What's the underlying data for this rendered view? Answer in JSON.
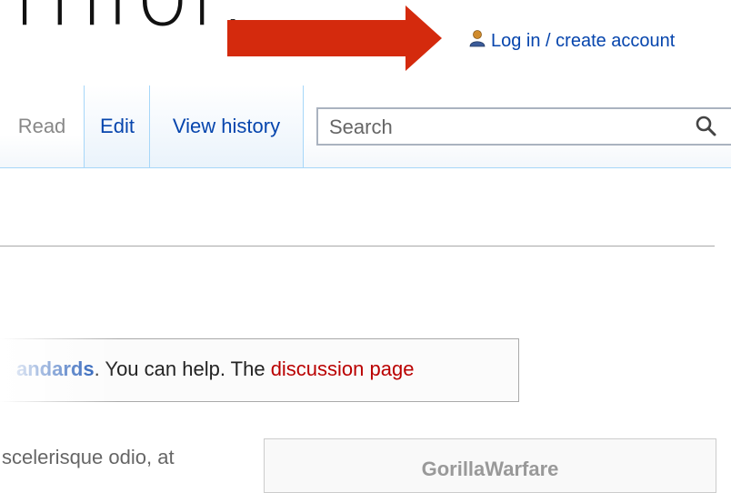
{
  "page": {
    "heading_fragment": "rnfor."
  },
  "header": {
    "login_label": "Log in / create account",
    "user_icon": "user-icon",
    "arrow_color": "#d42a0d"
  },
  "tabs": {
    "read_label": "Read",
    "edit_label": "Edit",
    "history_label": "View history"
  },
  "search": {
    "placeholder": "Search",
    "icon": "search-icon"
  },
  "notice": {
    "link_standards": "andards",
    "text_1": ". You can help. The ",
    "link_discussion": "discussion page"
  },
  "body": {
    "text": "scelerisque odio, at"
  },
  "infobox": {
    "title": "GorillaWarfare"
  },
  "colors": {
    "link": "#0645ad",
    "redlink": "#ba0000",
    "tab_border": "#a7d7f9"
  }
}
